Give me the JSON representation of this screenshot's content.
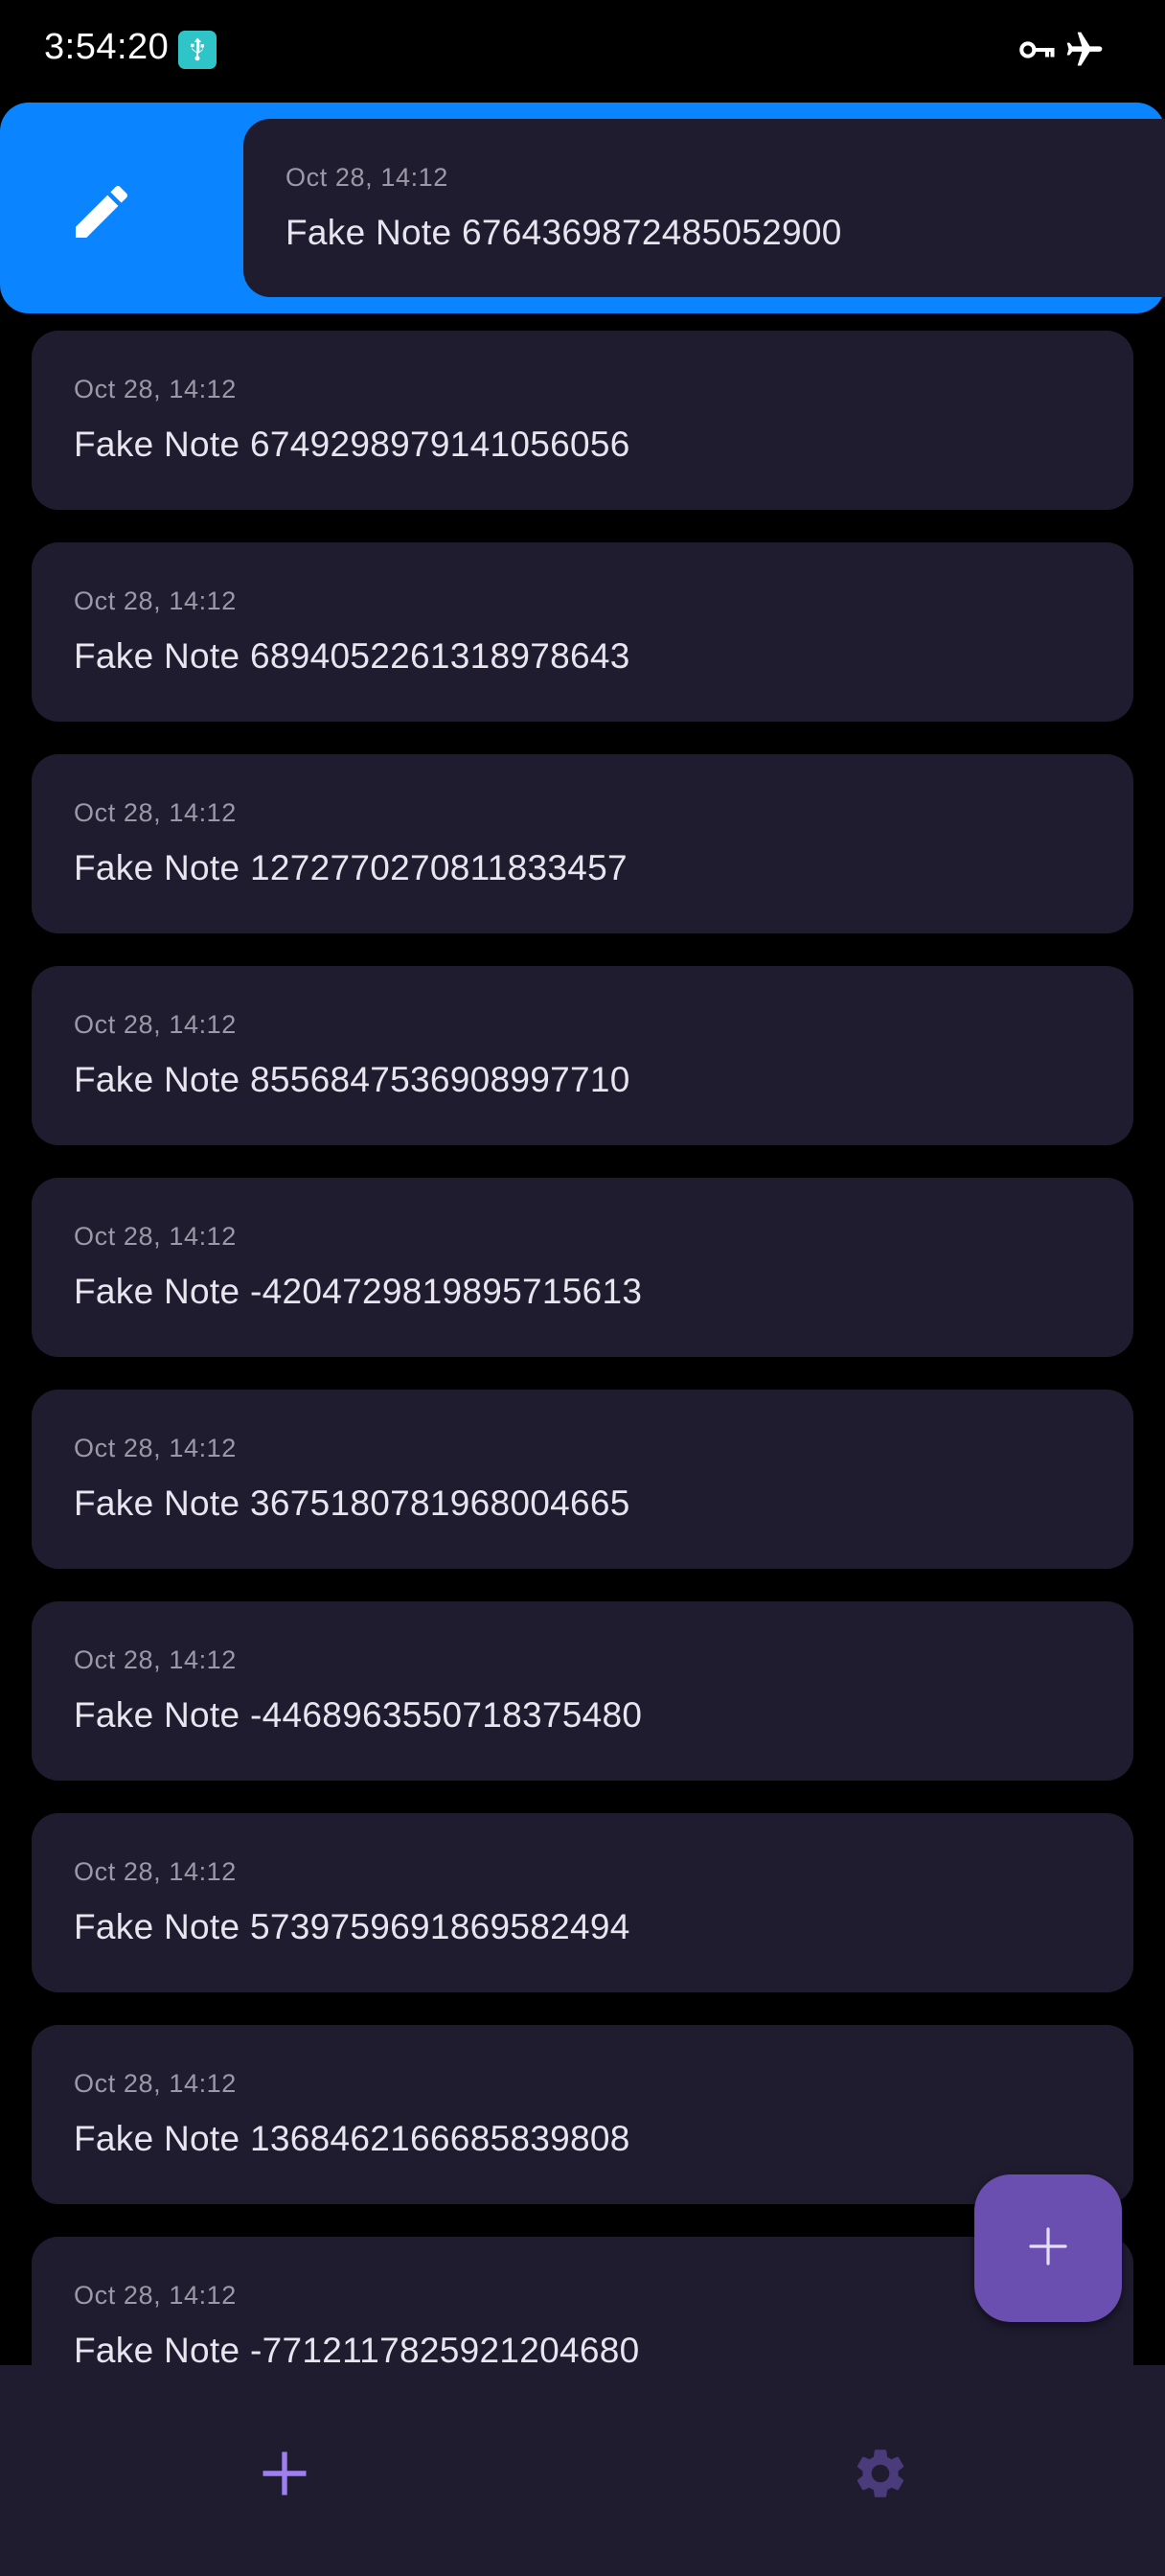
{
  "status_bar": {
    "time": "3:54:20",
    "icons": [
      "usb-debug-icon",
      "vpn-key-icon",
      "airplane-mode-icon"
    ]
  },
  "swiped_note": {
    "action_icon": "edit-icon",
    "action_color": "#0a84ff",
    "date": "Oct 28, 14:12",
    "title": "Fake Note 6764369872485052900"
  },
  "notes": [
    {
      "date": "Oct 28, 14:12",
      "title": "Fake Note 6749298979141056056"
    },
    {
      "date": "Oct 28, 14:12",
      "title": "Fake Note 6894052261318978643"
    },
    {
      "date": "Oct 28, 14:12",
      "title": "Fake Note 1272770270811833457"
    },
    {
      "date": "Oct 28, 14:12",
      "title": "Fake Note 8556847536908997710"
    },
    {
      "date": "Oct 28, 14:12",
      "title": "Fake Note -4204729819895715613"
    },
    {
      "date": "Oct 28, 14:12",
      "title": "Fake Note 3675180781968004665"
    },
    {
      "date": "Oct 28, 14:12",
      "title": "Fake Note -4468963550718375480"
    },
    {
      "date": "Oct 28, 14:12",
      "title": "Fake Note 5739759691869582494"
    },
    {
      "date": "Oct 28, 14:12",
      "title": "Fake Note 1368462166685839808"
    },
    {
      "date": "Oct 28, 14:12",
      "title": "Fake Note -7712117825921204680"
    }
  ],
  "fab": {
    "icon": "plus-icon",
    "color": "#6a4fb0"
  },
  "bottom_nav": {
    "items": [
      {
        "icon": "add-icon",
        "color": "#9d7ff0"
      },
      {
        "icon": "gear-icon",
        "color": "#4a3b7a"
      }
    ]
  },
  "colors": {
    "background": "#000000",
    "card": "#1f1c30",
    "text_primary": "#e8e5ef",
    "text_secondary": "#9c98a8"
  }
}
